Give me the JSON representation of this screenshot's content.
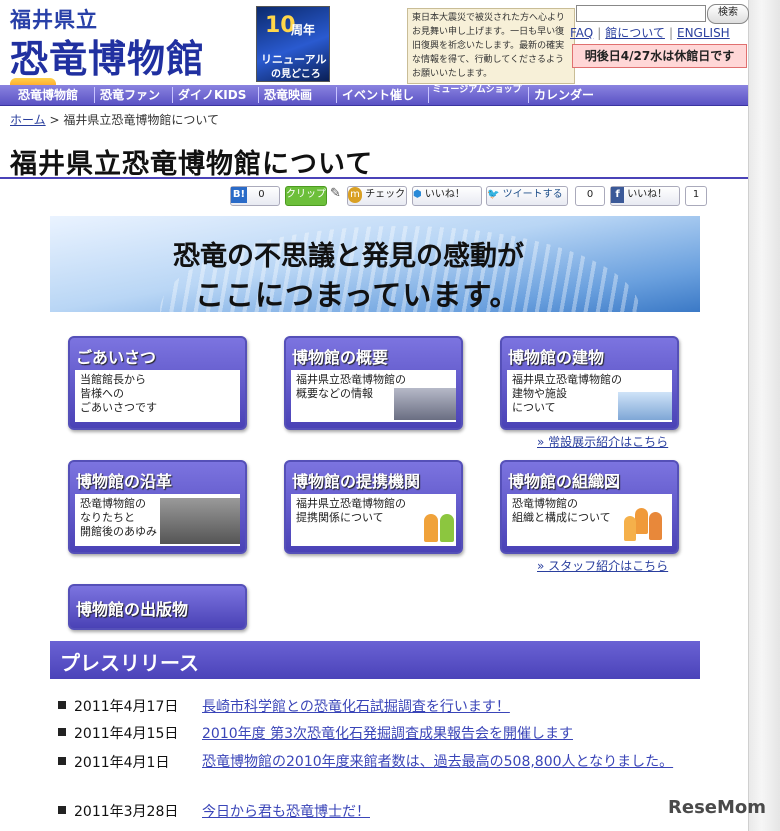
{
  "header": {
    "logo_line1": "福井県立",
    "logo_line2": "恐竜博物館",
    "anniversary": {
      "num": "10",
      "suffix": "周年",
      "line2": "リニューアル",
      "line3": "の見どころ"
    },
    "notice": "東日本大震災で被災された方へ心よりお見舞い申し上げます。一日も早い復旧復興を祈念いたします。最新の確実な情報を得て、行動してくださるようお願いいたします。",
    "search_placeholder": "",
    "search_button": "検索",
    "top_links": [
      "FAQ",
      "館について",
      "ENGLISH"
    ],
    "closed_notice": "明後日4/27水は休館日です"
  },
  "nav": [
    "恐竜博物館",
    "恐竜ファン",
    "ダイノKIDS",
    "恐竜映画",
    "イベント催し",
    "ミュージアムショップ",
    "カレンダー"
  ],
  "breadcrumb": {
    "home": "ホーム",
    "sep": ">",
    "current": "福井県立恐竜博物館について"
  },
  "page_title": "福井県立恐竜博物館について",
  "social": {
    "hatena_count": "0",
    "clip": "クリップ",
    "check": "チェック",
    "iine": "いいね！",
    "tweet": "ツイートする",
    "tweet_count": "0",
    "fb_like": "いいね！",
    "fb_count": "1"
  },
  "banner": {
    "line1": "恐竜の不思議と発見の感動が",
    "line2": "ここにつまっています。"
  },
  "tiles": [
    {
      "title": "ごあいさつ",
      "lines": [
        "当館館長から",
        "皆様への",
        "ごあいさつです"
      ]
    },
    {
      "title": "博物館の概要",
      "lines": [
        "福井県立恐竜博物館の",
        "概要などの情報"
      ]
    },
    {
      "title": "博物館の建物",
      "lines": [
        "福井県立恐竜博物館の",
        "建物や施設",
        "について"
      ]
    },
    {
      "title": "博物館の沿革",
      "lines": [
        "恐竜博物館の",
        "なりたちと",
        "開館後のあゆみ"
      ]
    },
    {
      "title": "博物館の提携機関",
      "lines": [
        "福井県立恐竜博物館の",
        "提携関係について"
      ]
    },
    {
      "title": "博物館の組織図",
      "lines": [
        "恐竜博物館の",
        "組織と構成について"
      ]
    },
    {
      "title": "博物館の出版物",
      "lines": []
    }
  ],
  "more_links": {
    "exhibit": "» 常設展示紹介はこちら",
    "staff": "» スタッフ紹介はこちら"
  },
  "press": {
    "heading": "プレスリリース",
    "items": [
      {
        "date": "2011年4月17日",
        "text": "長崎市科学館との恐竜化石試掘調査を行います！"
      },
      {
        "date": "2011年4月15日",
        "text": "2010年度 第3次恐竜化石発掘調査成果報告会を開催します"
      },
      {
        "date": "2011年4月1日",
        "text": "恐竜博物館の2010年度来館者数は、過去最高の508,800人となりました。"
      },
      {
        "date": "2011年3月28日",
        "text": "今日から君も恐竜博士だ！"
      }
    ]
  },
  "watermark": "ReseMom"
}
